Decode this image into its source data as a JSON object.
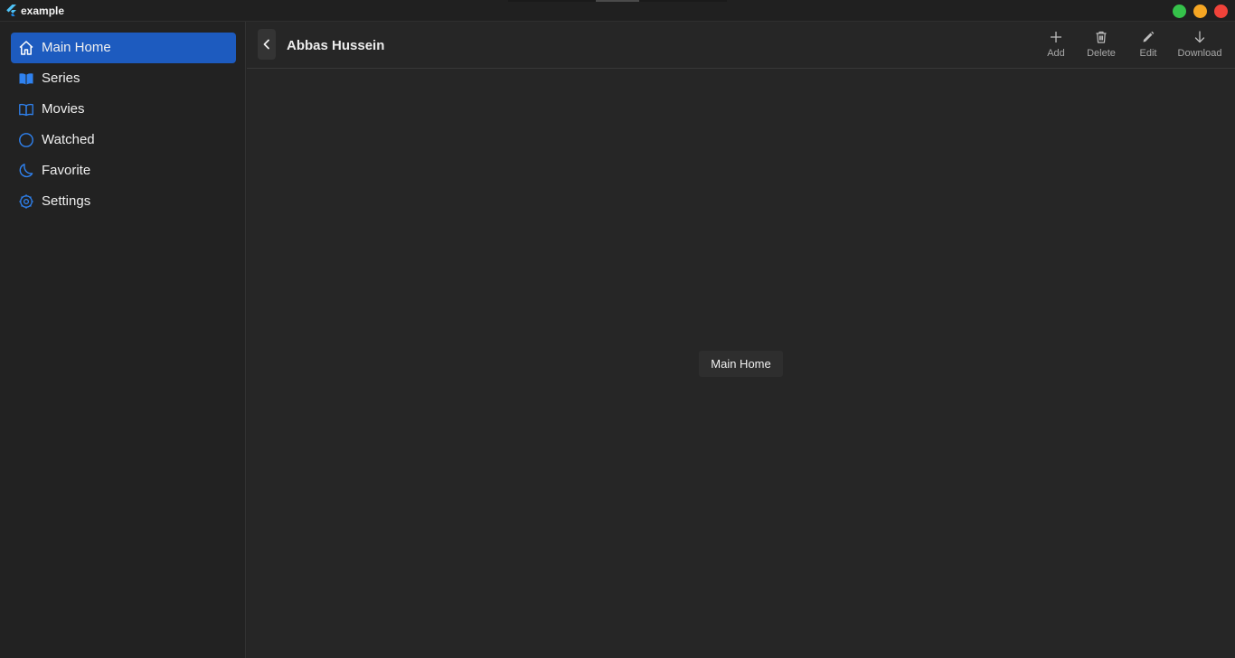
{
  "window": {
    "title": "example",
    "controls": [
      {
        "name": "maximize",
        "color": "#35c24a"
      },
      {
        "name": "minimize",
        "color": "#f5a623"
      },
      {
        "name": "close",
        "color": "#f0433a"
      }
    ]
  },
  "sidebar": {
    "items": [
      {
        "label": "Main Home",
        "icon": "home-icon",
        "active": true
      },
      {
        "label": "Series",
        "icon": "book-open-filled-icon",
        "active": false
      },
      {
        "label": "Movies",
        "icon": "book-open-outline-icon",
        "active": false
      },
      {
        "label": "Watched",
        "icon": "circle-icon",
        "active": false
      },
      {
        "label": "Favorite",
        "icon": "moon-icon",
        "active": false
      },
      {
        "label": "Settings",
        "icon": "gear-icon",
        "active": false
      }
    ]
  },
  "header": {
    "title": "Abbas Hussein",
    "actions": [
      {
        "label": "Add",
        "icon": "plus-icon"
      },
      {
        "label": "Delete",
        "icon": "trash-icon"
      },
      {
        "label": "Edit",
        "icon": "pencil-icon"
      },
      {
        "label": "Download",
        "icon": "arrow-down-icon"
      }
    ]
  },
  "content": {
    "label": "Main Home"
  },
  "colors": {
    "accent": "#1d5bbf",
    "icon_blue": "#2f82f0"
  }
}
